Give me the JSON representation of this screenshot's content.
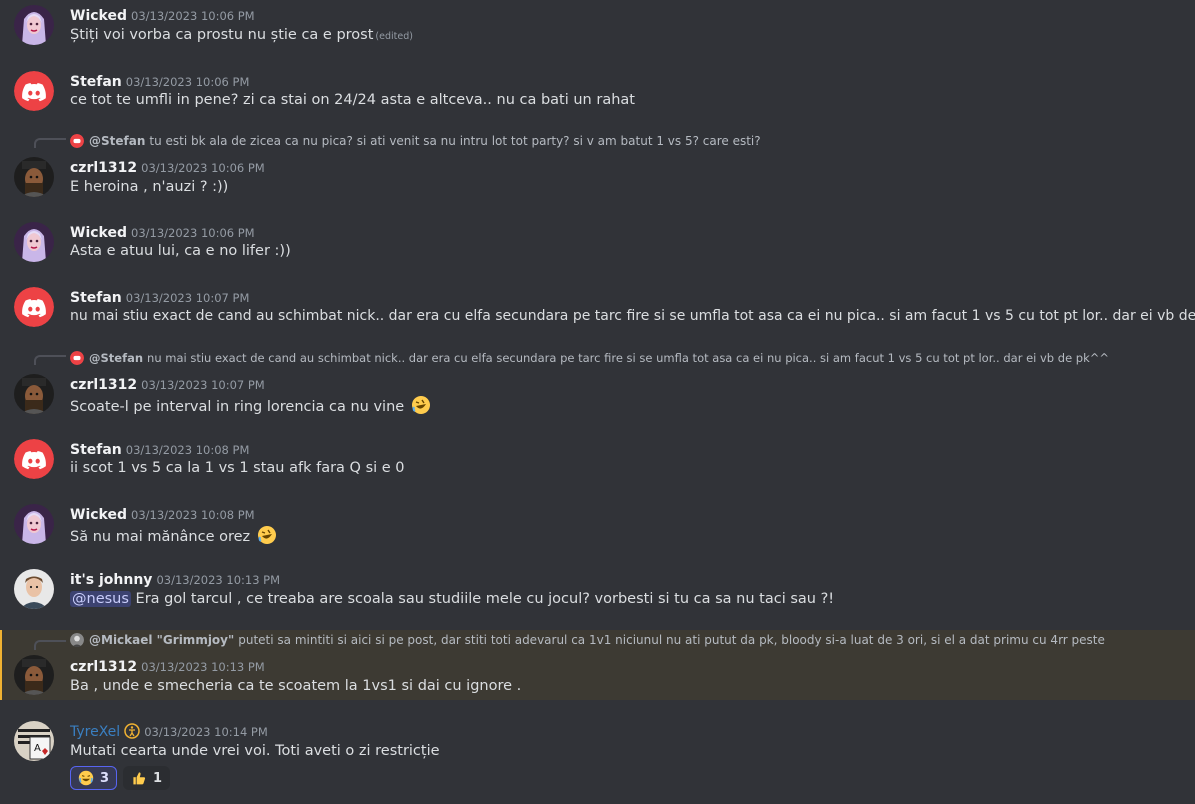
{
  "messages": [
    {
      "user": "Wicked",
      "time": "03/13/2023 10:06 PM",
      "text": "Știți voi vorba ca prostu nu știe ca e prost",
      "edited": "(edited)"
    },
    {
      "user": "Stefan",
      "time": "03/13/2023 10:06 PM",
      "text": "ce tot te umfli in pene? zi ca stai on 24/24 asta e altceva.. nu ca bati un rahat"
    },
    {
      "user": "czrl1312",
      "time": "03/13/2023 10:06 PM",
      "text": "E heroina , n'auzi ? :))",
      "reply": {
        "name": "@Stefan",
        "text": "tu esti bk ala de zicea ca nu pica? si ati venit sa nu intru lot tot party? si v am batut 1 vs 5? care esti?"
      }
    },
    {
      "user": "Wicked",
      "time": "03/13/2023 10:06 PM",
      "text": "Asta e atuu lui, ca e no lifer :))"
    },
    {
      "user": "Stefan",
      "time": "03/13/2023 10:07 PM",
      "text": "nu mai stiu exact de cand au schimbat nick.. dar era cu elfa secundara pe tarc fire si se umfla tot asa ca ei nu pica.. si am facut 1 vs 5 cu tot pt lor.. dar ei vb de pk^^"
    },
    {
      "user": "czrl1312",
      "time": "03/13/2023 10:07 PM",
      "text": "Scoate-l pe interval in ring lorencia ca nu vine",
      "reply": {
        "name": "@Stefan",
        "text": "nu mai stiu exact de cand au schimbat nick.. dar era cu elfa secundara pe tarc fire si se umfla tot asa ca ei nu pica.. si am facut 1 vs 5 cu tot pt lor.. dar ei vb de pk^^"
      }
    },
    {
      "user": "Stefan",
      "time": "03/13/2023 10:08 PM",
      "text": "ii scot 1 vs 5 ca la 1 vs 1 stau afk fara Q si e 0"
    },
    {
      "user": "Wicked",
      "time": "03/13/2023 10:08 PM",
      "text": "Să nu mai mănânce orez"
    },
    {
      "user": "it's johnny",
      "time": "03/13/2023 10:13 PM",
      "mention": "@nesus",
      "text": "Era gol tarcul , ce treaba are scoala sau studiile mele cu jocul? vorbesti si tu ca sa nu taci sau ?!"
    },
    {
      "user": "czrl1312",
      "time": "03/13/2023 10:13 PM",
      "text": "Ba , unde e smecheria ca te scoatem la 1vs1 si dai cu ignore .",
      "reply": {
        "name": "@Mickael \"Grimmjoy\"",
        "text": "puteti sa mintiti si aici si pe post, dar stiti toti adevarul ca 1v1 niciunul nu ati putut da pk, bloody si-a luat de 3 ori, si el a dat primu cu 4rr peste"
      }
    },
    {
      "user": "TyreXel",
      "time": "03/13/2023 10:14 PM",
      "text": "Mutati cearta unde vrei voi. Toti aveti o zi restricție",
      "reactions": [
        {
          "emoji": "crying-laughing",
          "count": "3"
        },
        {
          "emoji": "thumbs-up",
          "count": "1"
        }
      ]
    }
  ],
  "colors": {
    "background": "#313338",
    "highlight": "#3d3a33",
    "mention_bg": "#3c4270",
    "tyrexel_name": "#3a7fc1",
    "discord_red": "#ed4245"
  }
}
